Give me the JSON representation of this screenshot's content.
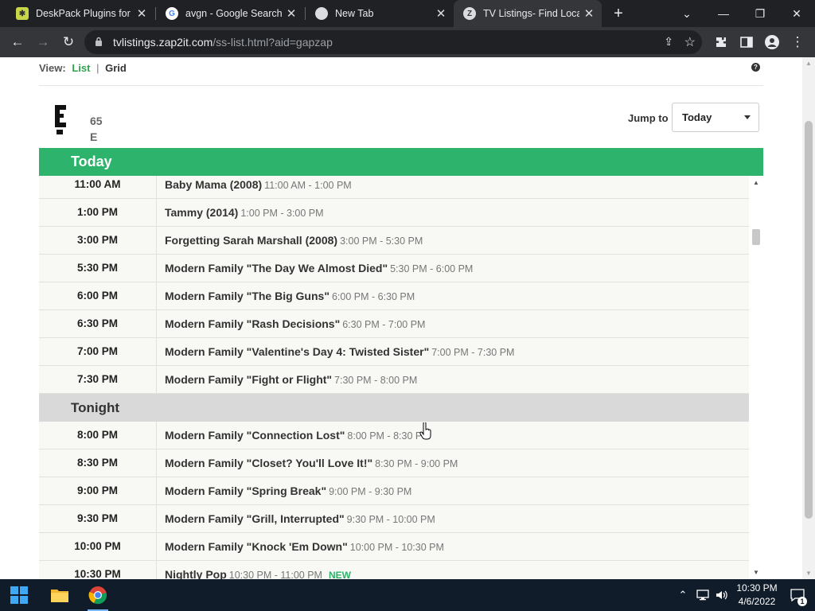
{
  "browser": {
    "tabs": [
      {
        "title": "DeskPack Plugins for Ad",
        "active": false
      },
      {
        "title": "avgn - Google Search",
        "active": false
      },
      {
        "title": "New Tab",
        "active": false
      },
      {
        "title": "TV Listings- Find Local",
        "active": true
      }
    ],
    "url_host": "tvlistings.zap2it.com",
    "url_path": "/ss-list.html?aid=gapzap"
  },
  "view": {
    "label": "View:",
    "list": "List",
    "separator": "|",
    "grid": "Grid",
    "help": "?"
  },
  "channel": {
    "number": "65",
    "callsign": "E"
  },
  "jump": {
    "label": "Jump to",
    "selected": "Today"
  },
  "day_header": "Today",
  "listings_today": [
    {
      "time": "11:00 AM",
      "show": "Baby Mama (2008)",
      "range": "11:00 AM - 1:00 PM"
    },
    {
      "time": "1:00 PM",
      "show": "Tammy (2014)",
      "range": "1:00 PM - 3:00 PM"
    },
    {
      "time": "3:00 PM",
      "show": "Forgetting Sarah Marshall (2008)",
      "range": "3:00 PM - 5:30 PM"
    },
    {
      "time": "5:30 PM",
      "show": "Modern Family \"The Day We Almost Died\"",
      "range": "5:30 PM - 6:00 PM"
    },
    {
      "time": "6:00 PM",
      "show": "Modern Family \"The Big Guns\"",
      "range": "6:00 PM - 6:30 PM"
    },
    {
      "time": "6:30 PM",
      "show": "Modern Family \"Rash Decisions\"",
      "range": "6:30 PM - 7:00 PM"
    },
    {
      "time": "7:00 PM",
      "show": "Modern Family \"Valentine's Day 4: Twisted Sister\"",
      "range": "7:00 PM - 7:30 PM"
    },
    {
      "time": "7:30 PM",
      "show": "Modern Family \"Fight or Flight\"",
      "range": "7:30 PM - 8:00 PM"
    }
  ],
  "section_tonight": "Tonight",
  "listings_tonight": [
    {
      "time": "8:00 PM",
      "show": "Modern Family \"Connection Lost\"",
      "range": "8:00 PM - 8:30 PM"
    },
    {
      "time": "8:30 PM",
      "show": "Modern Family \"Closet? You'll Love It!\"",
      "range": "8:30 PM - 9:00 PM"
    },
    {
      "time": "9:00 PM",
      "show": "Modern Family \"Spring Break\"",
      "range": "9:00 PM - 9:30 PM"
    },
    {
      "time": "9:30 PM",
      "show": "Modern Family \"Grill, Interrupted\"",
      "range": "9:30 PM - 10:00 PM"
    },
    {
      "time": "10:00 PM",
      "show": "Modern Family \"Knock 'Em Down\"",
      "range": "10:00 PM - 10:30 PM"
    },
    {
      "time": "10:30 PM",
      "show": "Nightly Pop",
      "range": "10:30 PM - 11:00 PM",
      "tag": "NEW"
    }
  ],
  "taskbar": {
    "time": "10:30 PM",
    "date": "4/6/2022",
    "notification_count": "1"
  },
  "colors": {
    "accent_green": "#2db36b",
    "section_gray": "#d9d9d9"
  }
}
